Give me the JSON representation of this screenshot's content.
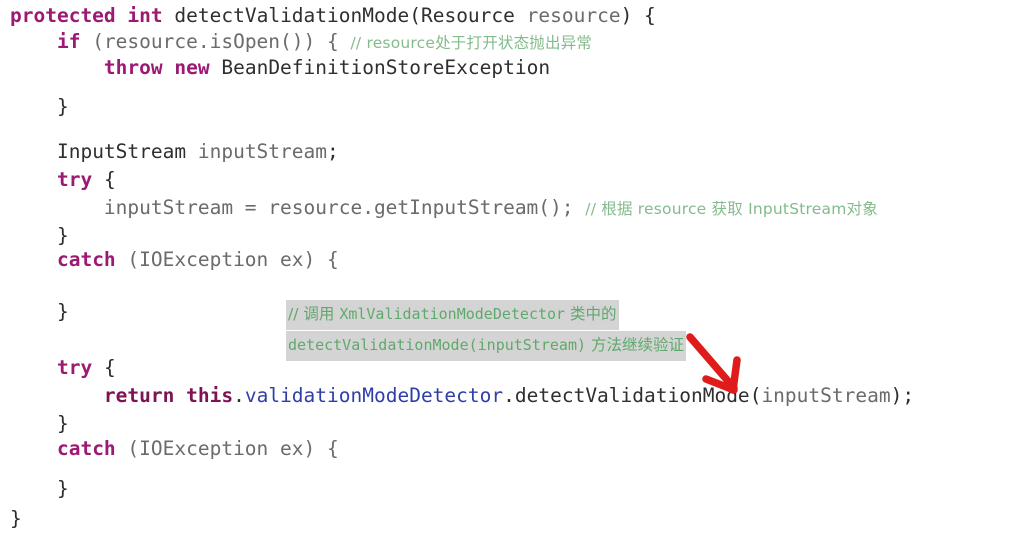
{
  "editor": {
    "language": "java",
    "background": "#ffffff",
    "font_size_px": 19.5,
    "line_height_px": 26
  },
  "colors": {
    "keyword": "#9c1a74",
    "identifier": "#6b6b6b",
    "type": "#2f2f2f",
    "field": "#2f3ea8",
    "comment": "#83bb8c",
    "annotation_highlight_bg": "#d4d4d4",
    "annotation_text": "#5fa96c",
    "arrow": "#e01b1b",
    "punctuation": "#2b2b2b"
  },
  "code": {
    "line1": {
      "kw_protected": "protected",
      "sp1": " ",
      "kw_int": "int",
      "sp2": " ",
      "method_name": "detectValidationMode",
      "open_paren": "(",
      "param_type": "Resource",
      "sp3": " ",
      "param_name": "resource",
      "close": ") {"
    },
    "line2": {
      "indent": "    ",
      "kw_if": "if",
      "expr": " (resource.isOpen()) { ",
      "comment": "// resource处于打开状态抛出异常"
    },
    "line3": {
      "indent": "        ",
      "kw_throw": "throw",
      "sp": " ",
      "kw_new": "new",
      "sp2": " ",
      "exception": "BeanDefinitionStoreException"
    },
    "line4": {
      "indent": "    ",
      "brace": "}"
    },
    "line6": {
      "indent": "    ",
      "type": "InputStream",
      "sp": " ",
      "var": "inputStream",
      "semi": ";"
    },
    "line7": {
      "indent": "    ",
      "kw_try": "try",
      "brace": " {"
    },
    "line8": {
      "indent": "        ",
      "assign": "inputStream = resource.getInputStream();",
      "sp": " ",
      "comment": "// 根据 resource 获取 InputStream对象"
    },
    "line9": {
      "indent": "    ",
      "brace": "}"
    },
    "line10": {
      "indent": "    ",
      "kw_catch": "catch",
      "rest": " (IOException ex) {"
    },
    "line12": {
      "indent": "    ",
      "brace": "}"
    },
    "line13": {
      "indent": "    ",
      "kw_try": "try",
      "brace": " {"
    },
    "line14": {
      "indent": "        ",
      "kw_return": "return",
      "sp": " ",
      "kw_this": "this",
      "dot1": ".",
      "field": "validationModeDetector",
      "dot2": ".",
      "call": "detectValidationMode",
      "open": "(",
      "arg": "inputStream",
      "close": ");"
    },
    "line15": {
      "indent": "    ",
      "brace": "}"
    },
    "line16": {
      "indent": "    ",
      "kw_catch": "catch",
      "rest": " (IOException ex) {"
    },
    "line18": {
      "indent": "    ",
      "brace": "}"
    },
    "line19": {
      "brace": "}"
    }
  },
  "annotation": {
    "line1_prefix": "// 调用 ",
    "line1_code": "XmlValidationModeDetector",
    "line1_suffix": " 类中的",
    "line2_code": "detectValidationMode(inputStream)",
    "line2_suffix": " 方法继续验证",
    "arrow_label": "points-to-detectValidationMode-call"
  }
}
